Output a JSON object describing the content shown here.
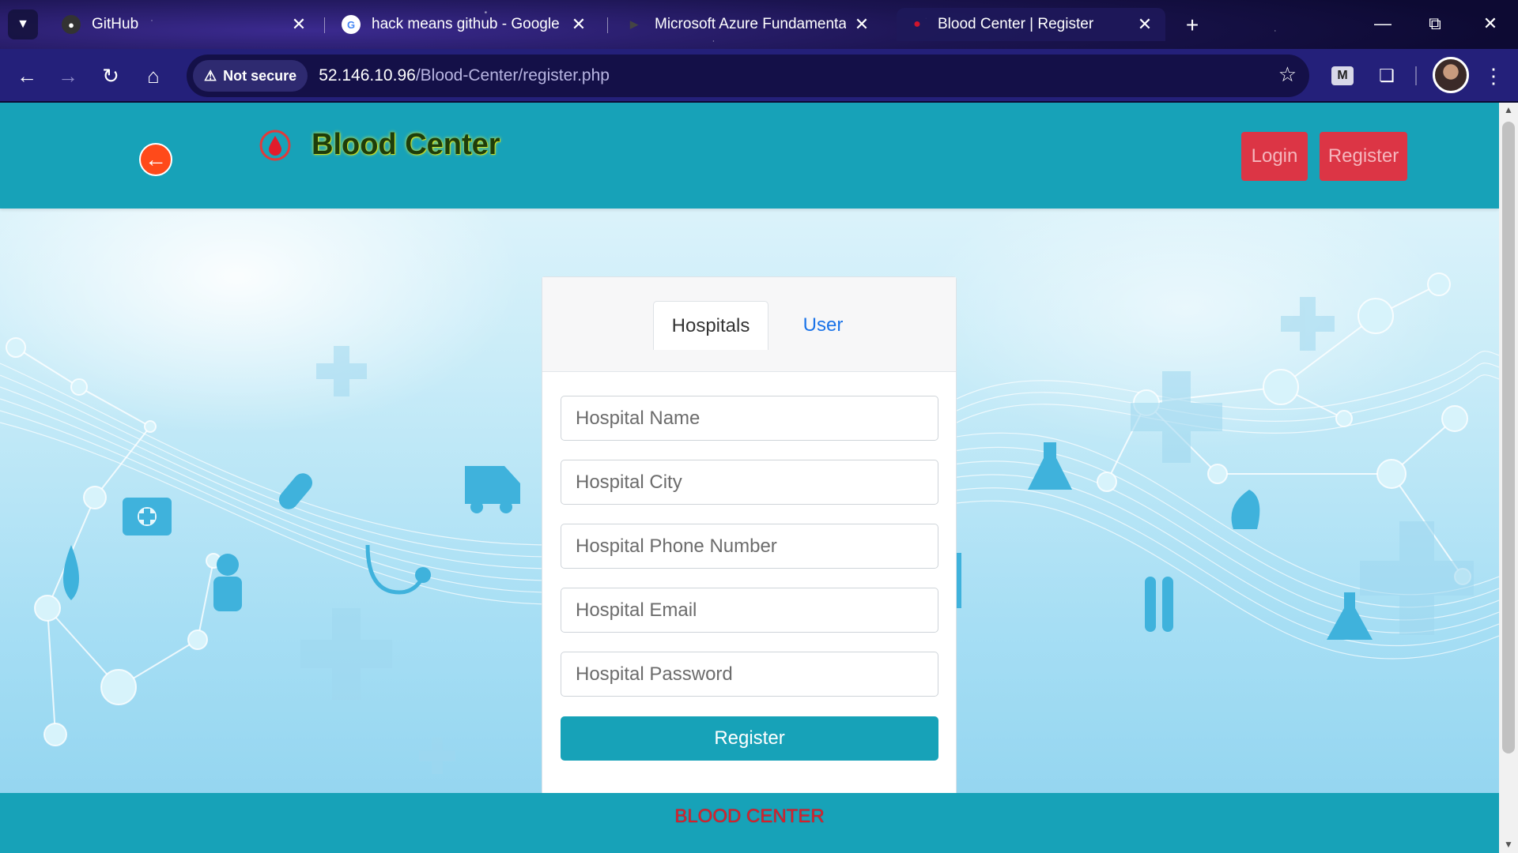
{
  "browser": {
    "tabs": [
      {
        "title": "GitHub",
        "favicon": "github-icon"
      },
      {
        "title": "hack means github - Google Se",
        "favicon": "google-icon"
      },
      {
        "title": "Microsoft Azure Fundamentals",
        "favicon": "youtube-icon"
      },
      {
        "title": "Blood Center | Register",
        "favicon": "blood-drop-icon",
        "active": true
      }
    ],
    "security_label": "Not secure",
    "url_host": "52.146.10.96",
    "url_path": "/Blood-Center/register.php",
    "extension_letter": "M"
  },
  "navbar": {
    "brand": "Blood Center",
    "login_label": "Login",
    "register_label": "Register",
    "color": "#17a2b8",
    "button_color": "#dc3545"
  },
  "form": {
    "tabs": [
      "Hospitals",
      "User"
    ],
    "active_tab": "Hospitals",
    "fields": [
      {
        "placeholder": "Hospital Name",
        "value": ""
      },
      {
        "placeholder": "Hospital City",
        "value": ""
      },
      {
        "placeholder": "Hospital Phone Number",
        "value": ""
      },
      {
        "placeholder": "Hospital Email",
        "value": ""
      },
      {
        "placeholder": "Hospital Password",
        "value": ""
      }
    ],
    "submit_label": "Register"
  },
  "footer": {
    "text": "BLOOD CENTER"
  }
}
